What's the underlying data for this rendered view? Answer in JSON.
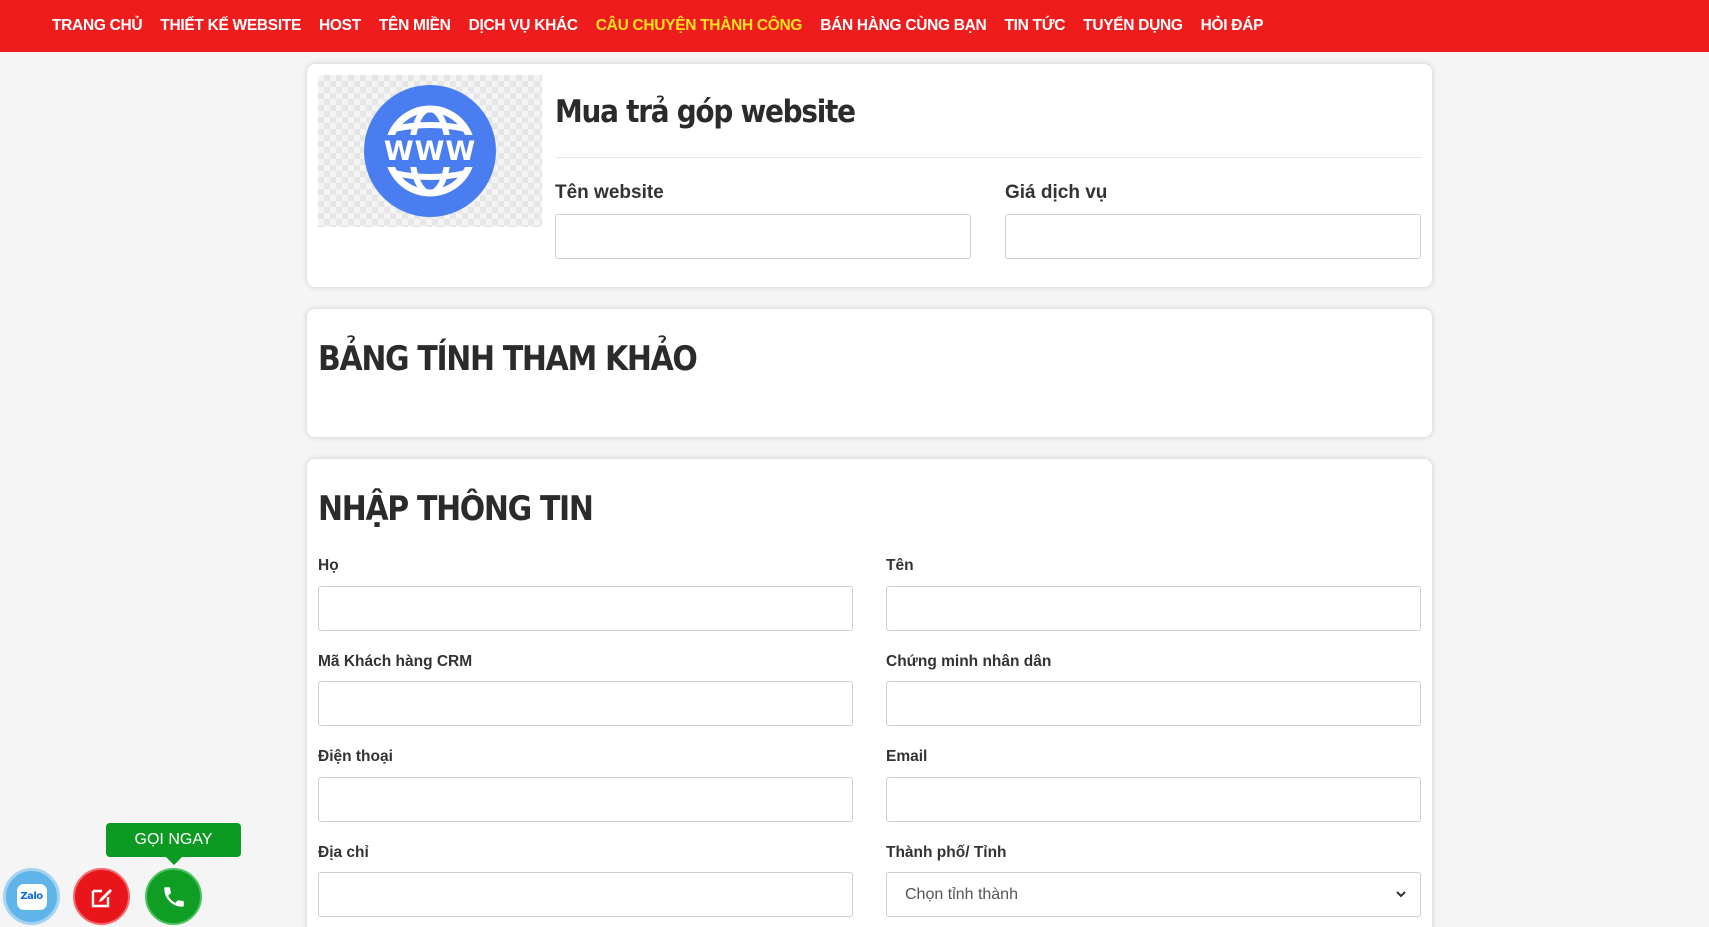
{
  "nav": {
    "items": [
      {
        "label": "TRANG CHỦ"
      },
      {
        "label": "THIẾT KẾ WEBSITE"
      },
      {
        "label": "HOST"
      },
      {
        "label": "TÊN MIỀN"
      },
      {
        "label": "DỊCH VỤ KHÁC"
      },
      {
        "label": "CÂU CHUYỆN THÀNH CÔNG"
      },
      {
        "label": "BÁN HÀNG CÙNG BẠN"
      },
      {
        "label": "TIN TỨC"
      },
      {
        "label": "TUYỂN DỤNG"
      },
      {
        "label": "HỎI ĐÁP"
      }
    ],
    "active_index": 5,
    "bg_color": "#ee1c1c",
    "active_color": "#ffe21f"
  },
  "product": {
    "icon": "www-globe-icon",
    "title": "Mua trả góp website",
    "website_name_label": "Tên website",
    "website_name_value": "",
    "price_label": "Giá dịch vụ",
    "price_value": ""
  },
  "reference": {
    "title": "BẢNG TÍNH THAM KHẢO"
  },
  "form": {
    "title": "NHẬP THÔNG TIN",
    "ho_label": "Họ",
    "ten_label": "Tên",
    "crm_label": "Mã Khách hàng CRM",
    "cmnd_label": "Chứng minh nhân dân",
    "phone_label": "Điện thoại",
    "email_label": "Email",
    "address_label": "Địa chỉ",
    "city_label": "Thành phố/ Tỉnh",
    "city_selected": "Chọn tỉnh thành"
  },
  "floating": {
    "zalo_text": "Zalo",
    "call_now_label": "GỌI NGAY"
  }
}
